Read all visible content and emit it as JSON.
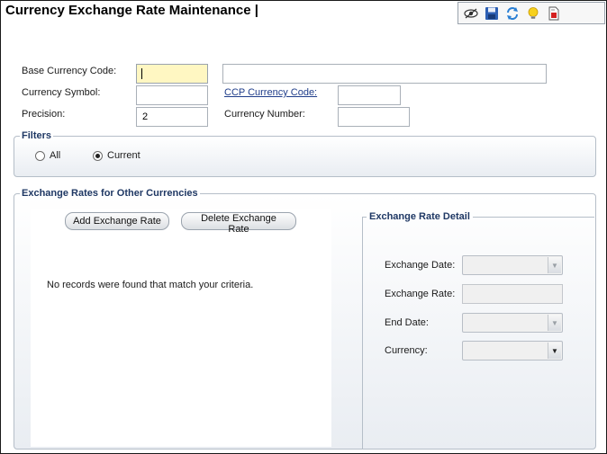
{
  "page": {
    "title": "Currency Exchange Rate Maintenance |"
  },
  "toolbar": {
    "buttons": [
      {
        "name": "view-icon"
      },
      {
        "name": "save-icon"
      },
      {
        "name": "refresh-icon"
      },
      {
        "name": "lightbulb-icon"
      },
      {
        "name": "report-icon"
      }
    ]
  },
  "form": {
    "base_currency_label": "Base Currency Code:",
    "base_currency_value": "",
    "base_currency_description": "",
    "currency_symbol_label": "Currency Symbol:",
    "currency_symbol_value": "",
    "ccp_currency_label": "CCP Currency Code:",
    "ccp_currency_value": "",
    "precision_label": "Precision:",
    "precision_value": "2",
    "currency_number_label": "Currency Number:",
    "currency_number_value": ""
  },
  "filters": {
    "legend": "Filters",
    "options": [
      {
        "label": "All",
        "selected": false
      },
      {
        "label": "Current",
        "selected": true
      }
    ]
  },
  "exchange_rates": {
    "legend": "Exchange Rates for Other Currencies",
    "add_button": "Add Exchange Rate",
    "delete_button": "Delete Exchange Rate",
    "empty_message": "No records were found that match your criteria."
  },
  "detail": {
    "legend": "Exchange Rate Detail",
    "exchange_date_label": "Exchange Date:",
    "exchange_date_value": "",
    "exchange_rate_label": "Exchange Rate:",
    "exchange_rate_value": "",
    "end_date_label": "End Date:",
    "end_date_value": "",
    "currency_label": "Currency:",
    "currency_value": ""
  },
  "colors": {
    "legend_text": "#1f3864",
    "focus_field": "#fff7c2",
    "group_bg_bottom": "#e9edf2",
    "link": "#1f3d8a"
  }
}
